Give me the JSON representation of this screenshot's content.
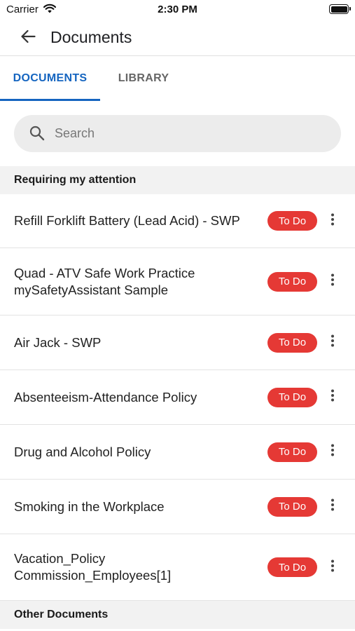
{
  "status_bar": {
    "carrier": "Carrier",
    "time": "2:30 PM"
  },
  "app_bar": {
    "title": "Documents"
  },
  "tabs": [
    {
      "label": "DOCUMENTS",
      "selected": true
    },
    {
      "label": "LIBRARY",
      "selected": false
    }
  ],
  "search": {
    "placeholder": "Search",
    "value": ""
  },
  "sections": {
    "attention": "Requiring my attention",
    "other": "Other Documents"
  },
  "documents": [
    {
      "title": "Refill Forklift Battery (Lead Acid) - SWP",
      "status": "To Do"
    },
    {
      "title": "Quad - ATV Safe Work Practice\nmySafetyAssistant Sample",
      "status": "To Do"
    },
    {
      "title": "Air Jack - SWP",
      "status": "To Do"
    },
    {
      "title": "Absenteeism-Attendance Policy",
      "status": "To Do"
    },
    {
      "title": "Drug and Alcohol Policy",
      "status": "To Do"
    },
    {
      "title": "Smoking in the Workplace",
      "status": "To Do"
    },
    {
      "title": "Vacation_Policy\nCommission_Employees[1]",
      "status": "To Do"
    }
  ],
  "colors": {
    "accent": "#1565c0",
    "badge": "#e53935",
    "section_bg": "#f2f2f2",
    "search_bg": "#ececec"
  },
  "icons": {
    "back": "arrow-back-icon",
    "search": "search-icon",
    "more": "more-vertical-icon",
    "wifi": "wifi-icon",
    "battery": "battery-icon"
  }
}
